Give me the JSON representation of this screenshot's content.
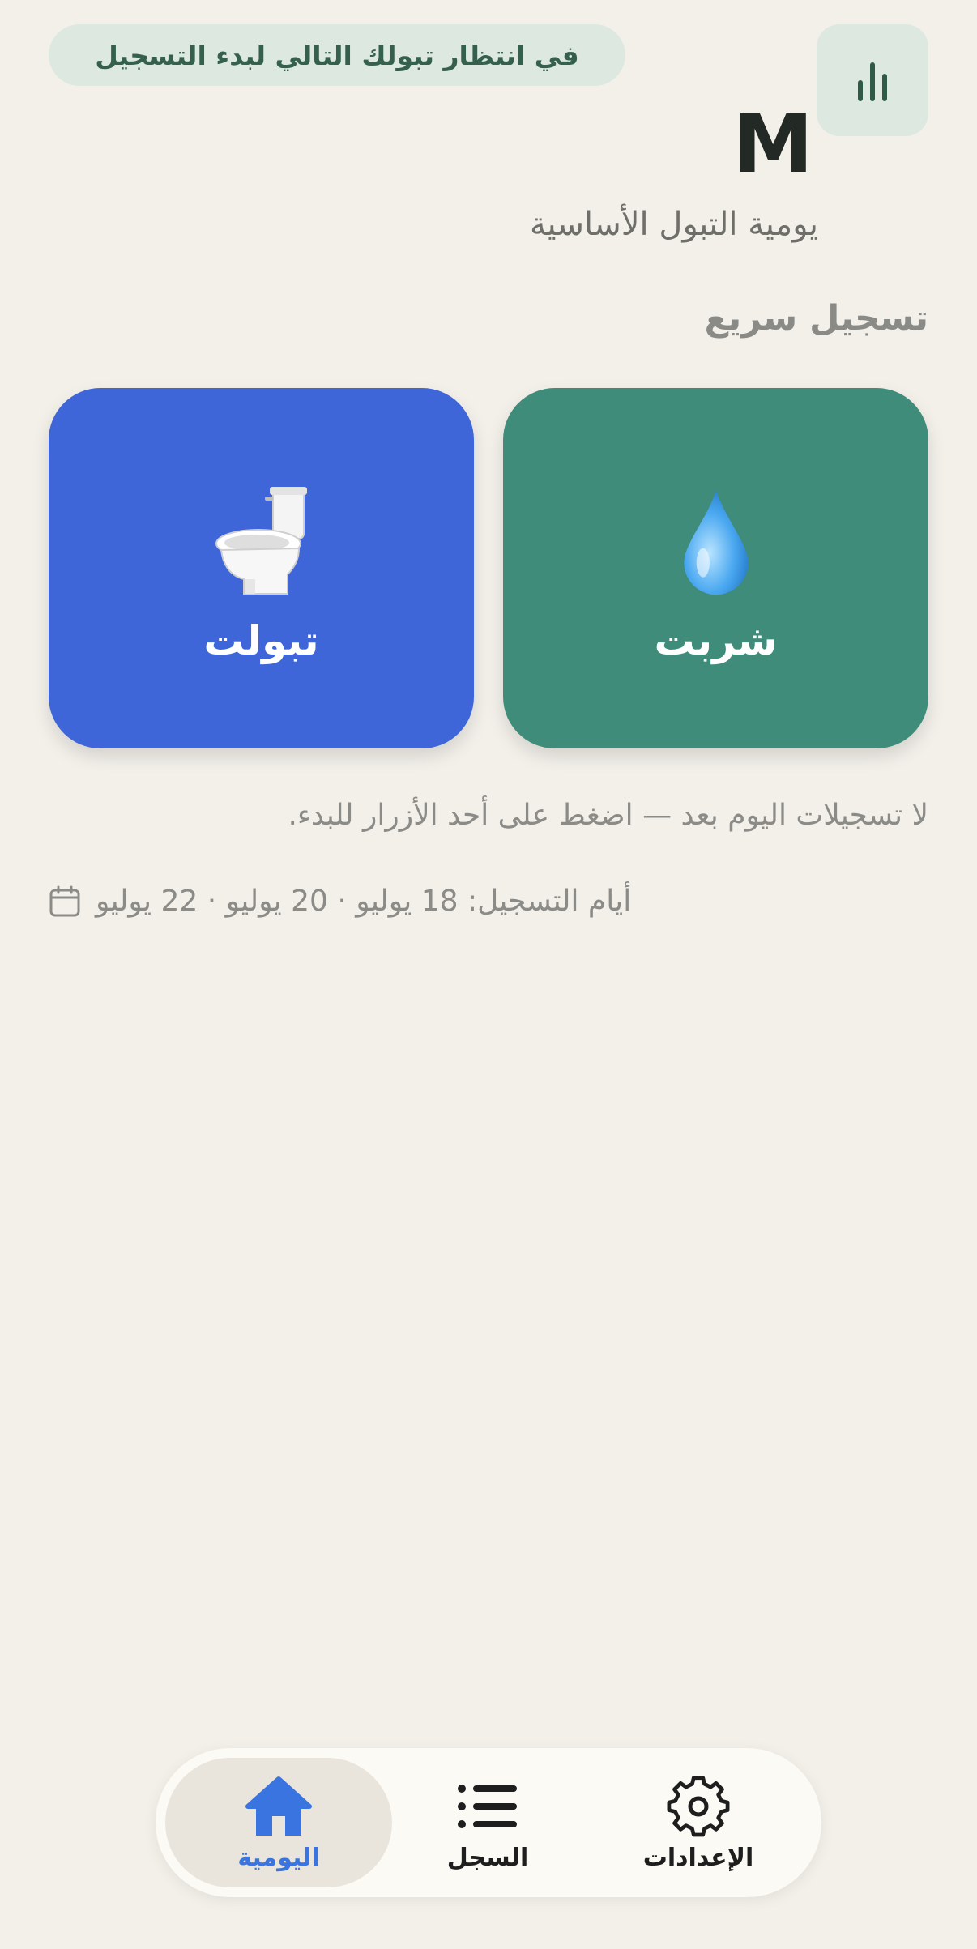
{
  "status_banner": "في انتظار تبولك التالي لبدء التسجيل",
  "header": {
    "initial": "M",
    "subtitle": "يومية التبول الأساسية"
  },
  "quick_log": {
    "title": "تسجيل سريع",
    "urinate_label": "تبولت",
    "urinate_emoji": "🚽",
    "drink_label": "شربت",
    "drink_emoji": "💧"
  },
  "empty_message": "لا تسجيلات اليوم بعد — اضغط على أحد الأزرار للبدء.",
  "logging_days": "أيام التسجيل: 18 يوليو · 20 يوليو · 22 يوليو",
  "nav": {
    "home_label": "اليومية",
    "log_label": "السجل",
    "settings_label": "الإعدادات",
    "active": "home"
  },
  "colors": {
    "background": "#f3f0ea",
    "urinate_card": "#3f66d9",
    "drink_card": "#408c7a",
    "accent": "#3a74e0",
    "status_pill": "#dde9e0"
  },
  "icons": {
    "stats": "bar-chart-icon",
    "calendar": "calendar-icon",
    "home": "home-icon",
    "log": "list-icon",
    "settings": "gear-icon"
  }
}
